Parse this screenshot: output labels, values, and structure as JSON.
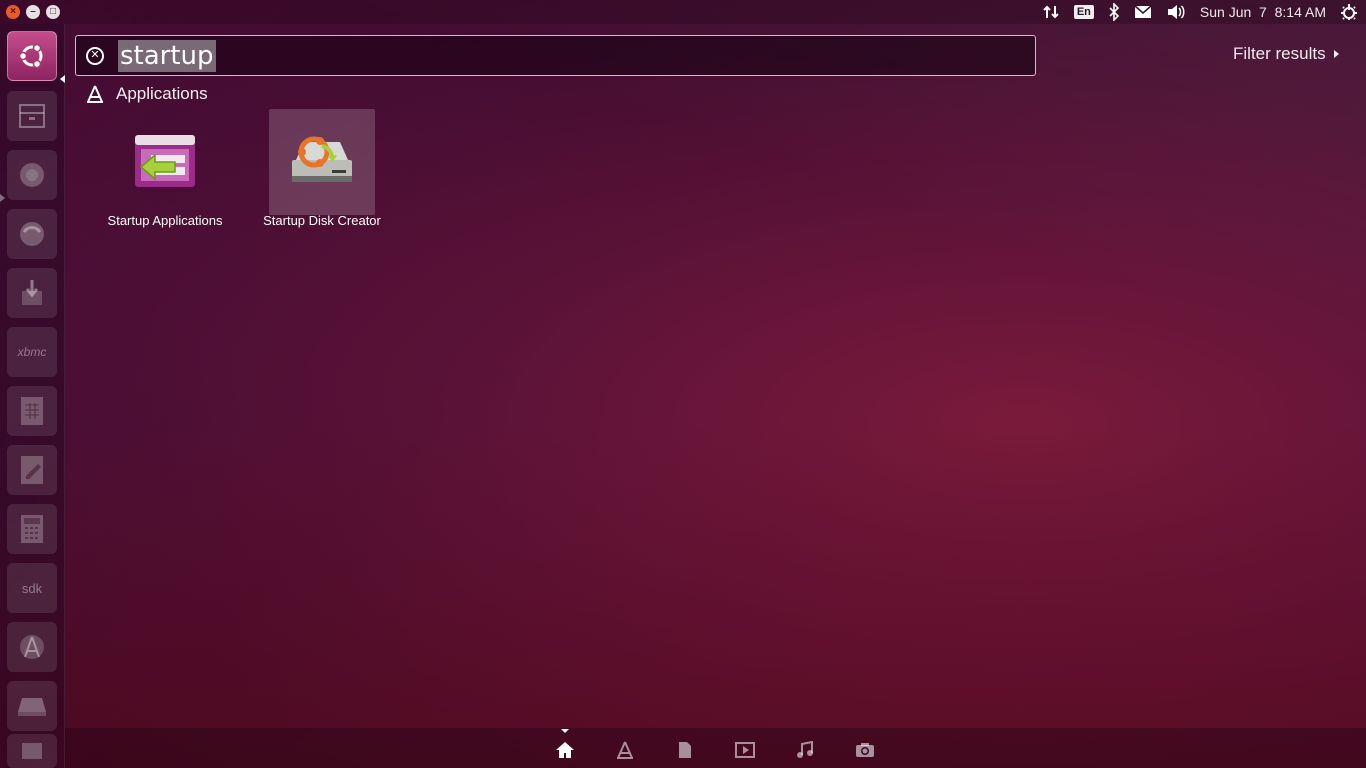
{
  "top_panel": {
    "window_controls": [
      "close",
      "minimize",
      "maximize"
    ],
    "keyboard_layout": "En",
    "clock": "Sun Jun  7  8:14 AM",
    "indicator_icons": [
      "network-icon",
      "keyboard-layout-icon",
      "bluetooth-icon",
      "mail-icon",
      "volume-icon",
      "session-gear-icon"
    ]
  },
  "launcher": {
    "items": [
      {
        "name": "dash-home",
        "icon": "ubuntu-logo-icon"
      },
      {
        "name": "files",
        "icon": "file-cabinet-icon"
      },
      {
        "name": "firefox",
        "icon": "firefox-icon"
      },
      {
        "name": "app-3",
        "icon": "app-icon"
      },
      {
        "name": "installer",
        "icon": "download-icon"
      },
      {
        "name": "xbmc",
        "icon": "xbmc-icon"
      },
      {
        "name": "spreadsheet",
        "icon": "spreadsheet-icon"
      },
      {
        "name": "text-editor",
        "icon": "text-editor-icon"
      },
      {
        "name": "calculator",
        "icon": "calculator-icon"
      },
      {
        "name": "sdk",
        "icon": "sdk-icon"
      },
      {
        "name": "android-studio",
        "icon": "android-studio-icon"
      },
      {
        "name": "drive",
        "icon": "drive-icon"
      },
      {
        "name": "trash",
        "icon": "trash-icon"
      }
    ],
    "xbmc_label": "xbmc",
    "sdk_label": "sdk"
  },
  "search": {
    "query": "startup",
    "filter_label": "Filter results"
  },
  "category": {
    "title": "Applications"
  },
  "results": [
    {
      "label": "Startup Applications",
      "icon": "startup-applications-icon",
      "selected": false
    },
    {
      "label": "Startup Disk Creator",
      "icon": "startup-disk-creator-icon",
      "selected": true
    }
  ],
  "lenses": [
    {
      "name": "home",
      "icon": "home-icon",
      "active": true
    },
    {
      "name": "applications",
      "icon": "applications-icon",
      "active": false
    },
    {
      "name": "files",
      "icon": "file-icon",
      "active": false
    },
    {
      "name": "video",
      "icon": "video-icon",
      "active": false
    },
    {
      "name": "music",
      "icon": "music-icon",
      "active": false
    },
    {
      "name": "photos",
      "icon": "camera-icon",
      "active": false
    }
  ],
  "colors": {
    "accent": "#c44d8c",
    "close_button": "#e85a2a"
  }
}
